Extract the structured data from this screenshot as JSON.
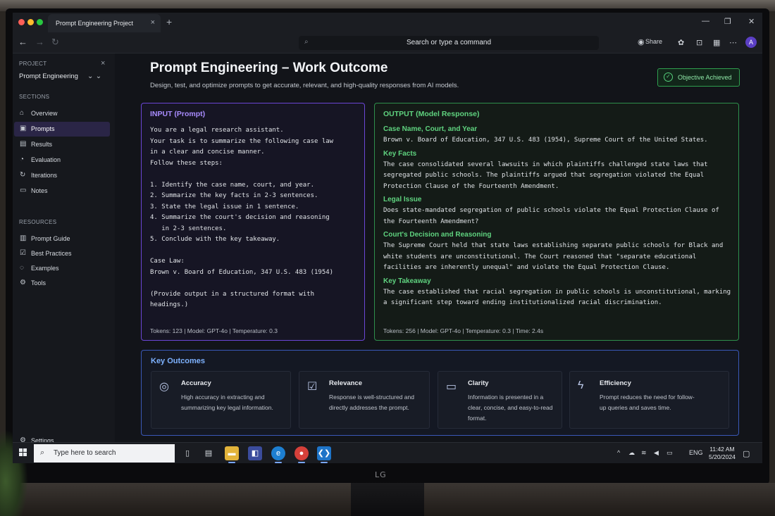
{
  "browser": {
    "tab_title": "Prompt Engineering Project",
    "tab_close": "×",
    "new_tab": "+",
    "omnibox_placeholder": "Search or type a command",
    "share_label": "Share",
    "avatar_initial": "A"
  },
  "sidebar": {
    "project_caption": "PROJECT",
    "project_name": "Prompt Engineering",
    "sections_caption": "SECTIONS",
    "sections": [
      {
        "label": "Overview",
        "icon": "home-icon"
      },
      {
        "label": "Prompts",
        "icon": "chat-icon",
        "active": true
      },
      {
        "label": "Results",
        "icon": "document-icon"
      },
      {
        "label": "Evaluation",
        "icon": "chart-icon"
      },
      {
        "label": "Iterations",
        "icon": "refresh-icon"
      },
      {
        "label": "Notes",
        "icon": "notes-icon"
      }
    ],
    "resources_caption": "RESOURCES",
    "resources": [
      {
        "label": "Prompt Guide",
        "icon": "book-icon"
      },
      {
        "label": "Best Practices",
        "icon": "checklist-icon"
      },
      {
        "label": "Examples",
        "icon": "lightbulb-icon"
      },
      {
        "label": "Tools",
        "icon": "wrench-icon"
      }
    ],
    "settings_label": "Settings"
  },
  "header": {
    "title": "Prompt Engineering – Work Outcome",
    "subtitle": "Design, test, and optimize prompts to get accurate, relevant, and high-quality responses from AI models.",
    "badge": "Objective Achieved"
  },
  "input_panel": {
    "title": "INPUT (Prompt)",
    "text": "You are a legal research assistant.\nYour task is to summarize the following case law\nin a clear and concise manner.\nFollow these steps:\n\n1. Identify the case name, court, and year.\n2. Summarize the key facts in 2-3 sentences.\n3. State the legal issue in 1 sentence.\n4. Summarize the court's decision and reasoning\n   in 2-3 sentences.\n5. Conclude with the key takeaway.\n\nCase Law:\nBrown v. Board of Education, 347 U.S. 483 (1954)\n\n(Provide output in a structured format with\nheadings.)",
    "meta": "Tokens:  123   |   Model:  GPT-4o   |   Temperature:  0.3"
  },
  "output_panel": {
    "title": "OUTPUT (Model Response)",
    "sections": [
      {
        "heading": "Case Name, Court, and Year",
        "text": "Brown v. Board of Education, 347 U.S. 483 (1954), Supreme Court of the United States."
      },
      {
        "heading": "Key Facts",
        "text": "The case consolidated several lawsuits in which plaintiffs challenged state laws that segregated public schools. The plaintiffs argued that segregation violated the Equal Protection Clause of the Fourteenth Amendment."
      },
      {
        "heading": "Legal Issue",
        "text": "Does state-mandated segregation of public schools violate the Equal Protection Clause of the Fourteenth Amendment?"
      },
      {
        "heading": "Court's Decision and Reasoning",
        "text": "The Supreme Court held that state laws establishing separate public schools for Black and white students are unconstitutional. The Court reasoned that \"separate educational facilities are inherently unequal\" and violate the Equal Protection Clause."
      },
      {
        "heading": "Key Takeaway",
        "text": "The case established that racial segregation in public schools is unconstitutional, marking a significant step toward ending institutionalized racial discrimination."
      }
    ],
    "meta": "Tokens:  256   |   Model:  GPT-4o   |   Temperature:  0.3   |   Time:  2.4s"
  },
  "outcomes": {
    "title": "Key Outcomes",
    "cards": [
      {
        "title": "Accuracy",
        "icon": "target-icon",
        "desc": "High accuracy in extracting and summarizing key legal information."
      },
      {
        "title": "Relevance",
        "icon": "check-square-icon",
        "desc": "Response is well-structured and directly addresses the prompt."
      },
      {
        "title": "Clarity",
        "icon": "speech-bubble-icon",
        "desc": "Information is presented in a clear, concise, and easy-to-read format."
      },
      {
        "title": "Efficiency",
        "icon": "lightning-icon",
        "desc": "Prompt reduces the need for follow-up queries and saves time."
      }
    ]
  },
  "taskbar": {
    "search_placeholder": "Type here to search",
    "language": "ENG",
    "time": "11:42 AM",
    "date": "5/20/2024"
  },
  "monitor": {
    "brand": "LG"
  },
  "colors": {
    "accent_purple": "#6b46d6",
    "accent_green": "#2e8f4c",
    "accent_blue": "#3a58b8",
    "heading_green": "#5fd37f"
  }
}
